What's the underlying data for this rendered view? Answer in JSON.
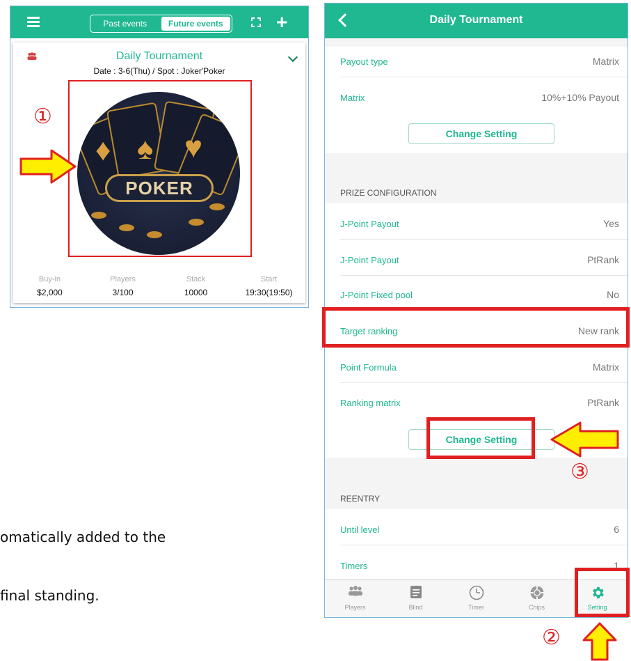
{
  "left": {
    "seg_past": "Past events",
    "seg_future": "Future events",
    "event_title": "Daily Tournament",
    "event_sub": "Date : 3-6(Thu) / Spot : Joker'Poker",
    "image_word": "POKER",
    "stat_labels": [
      "Buy-in",
      "Players",
      "Stack",
      "Start"
    ],
    "stat_values": [
      "$2,000",
      "3/100",
      "10000",
      "19:30(19:50)"
    ]
  },
  "annotations": {
    "one": "①",
    "two": "②",
    "three": "③",
    "red": "#e02020",
    "yellow": "#ffee00"
  },
  "background_text": {
    "line1": "omatically added to the",
    "line2": "final standing."
  },
  "right": {
    "title": "Daily Tournament",
    "rows_top": [
      {
        "label": "Payout type",
        "value": "Matrix"
      },
      {
        "label": "Matrix",
        "value": "10%+10% Payout"
      }
    ],
    "change_setting": "Change Setting",
    "section_prize": "PRIZE CONFIGURATION",
    "rows_prize": [
      {
        "label": "J-Point Payout",
        "value": "Yes"
      },
      {
        "label": "J-Point Payout",
        "value": "PtRank"
      },
      {
        "label": "J-Point Fixed pool",
        "value": "No"
      },
      {
        "label": "Target ranking",
        "value": "New rank"
      },
      {
        "label": "Point Formula",
        "value": "Matrix"
      },
      {
        "label": "Ranking matrix",
        "value": "PtRank"
      }
    ],
    "section_reentry": "REENTRY",
    "rows_reentry": [
      {
        "label": "Until level",
        "value": "6"
      },
      {
        "label": "Timers",
        "value": "1"
      }
    ],
    "tabs": [
      "Players",
      "Blind",
      "Timer",
      "Chips",
      "Setting"
    ]
  },
  "colors": {
    "brand": "#1fb890",
    "header_text": "#ffffff",
    "value_text": "#777777"
  }
}
